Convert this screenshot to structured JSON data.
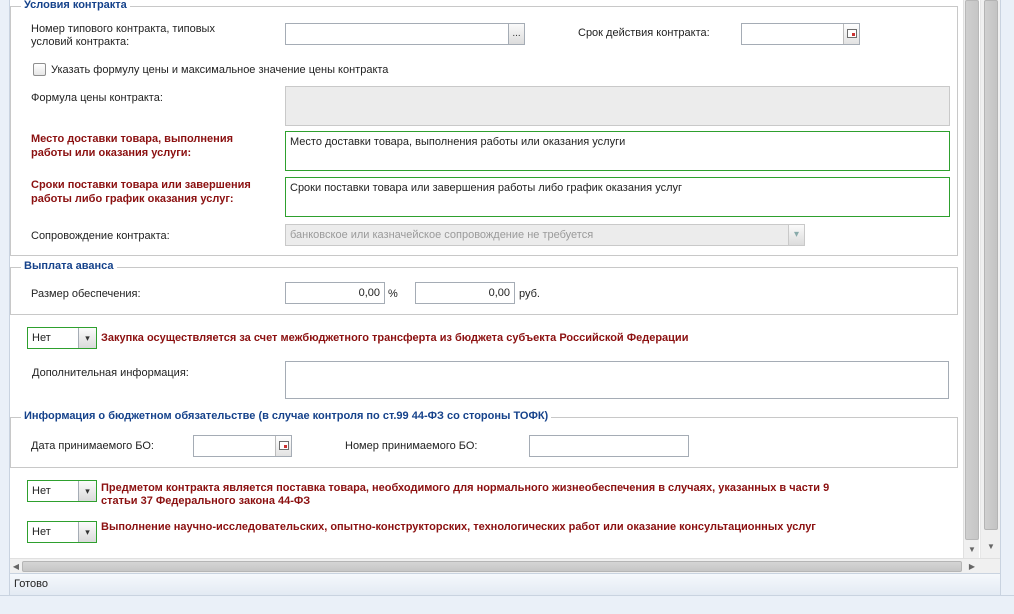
{
  "conditions": {
    "legend": "Условия контракта",
    "typical_contract_label": "Номер типового контракта, типовых условий контракта:",
    "typical_contract_value": "",
    "lookup_button": "...",
    "term_label": "Срок действия контракта:",
    "term_value": "",
    "formula_checkbox_label": "Указать формулу цены и максимальное значение цены контракта",
    "formula_checked": false,
    "formula_label": "Формула цены контракта:",
    "delivery_place_label": "Место доставки товара, выполнения работы или оказания услуги:",
    "delivery_place_value": "Место доставки товара, выполнения работы или оказания услуги",
    "delivery_terms_label": "Сроки поставки товара или завершения работы либо график оказания услуг:",
    "delivery_terms_value": "Сроки поставки товара или завершения работы либо график оказания услуг",
    "support_label": "Сопровождение контракта:",
    "support_value": "банковское или казначейское сопровождение не требуется"
  },
  "advance": {
    "legend": "Выплата аванса",
    "security_label": "Размер обеспечения:",
    "percent_value": "0,00",
    "percent_unit": "%",
    "rub_value": "0,00",
    "rub_unit": "руб."
  },
  "interbudget": {
    "select_value": "Нет",
    "label": "Закупка осуществляется за счет межбюджетного трансферта из бюджета субъекта Российской Федерации"
  },
  "additional_info": {
    "label": "Дополнительная информация:",
    "value": ""
  },
  "budget_obligation": {
    "legend": "Информация о бюджетном обязательстве (в случае контроля по ст.99 44-ФЗ со стороны ТОФК)",
    "date_label": "Дата принимаемого БО:",
    "date_value": "",
    "number_label": "Номер принимаемого БО:",
    "number_value": ""
  },
  "vital_goods": {
    "select_value": "Нет",
    "label_line1": "Предметом контракта является поставка товара, необходимого для нормального жизнеобеспечения в случаях, указанных в части 9",
    "label_line2": "статьи 37 Федерального закона 44-ФЗ"
  },
  "research": {
    "select_value": "Нет",
    "label": "Выполнение научно-исследовательских, опытно-конструкторских, технологических работ или оказание консультационных услуг"
  },
  "status_bar": {
    "text": "Готово"
  },
  "colors": {
    "legend": "#15428b",
    "required_label": "#8b1010",
    "valid_border": "#2ea02e"
  }
}
